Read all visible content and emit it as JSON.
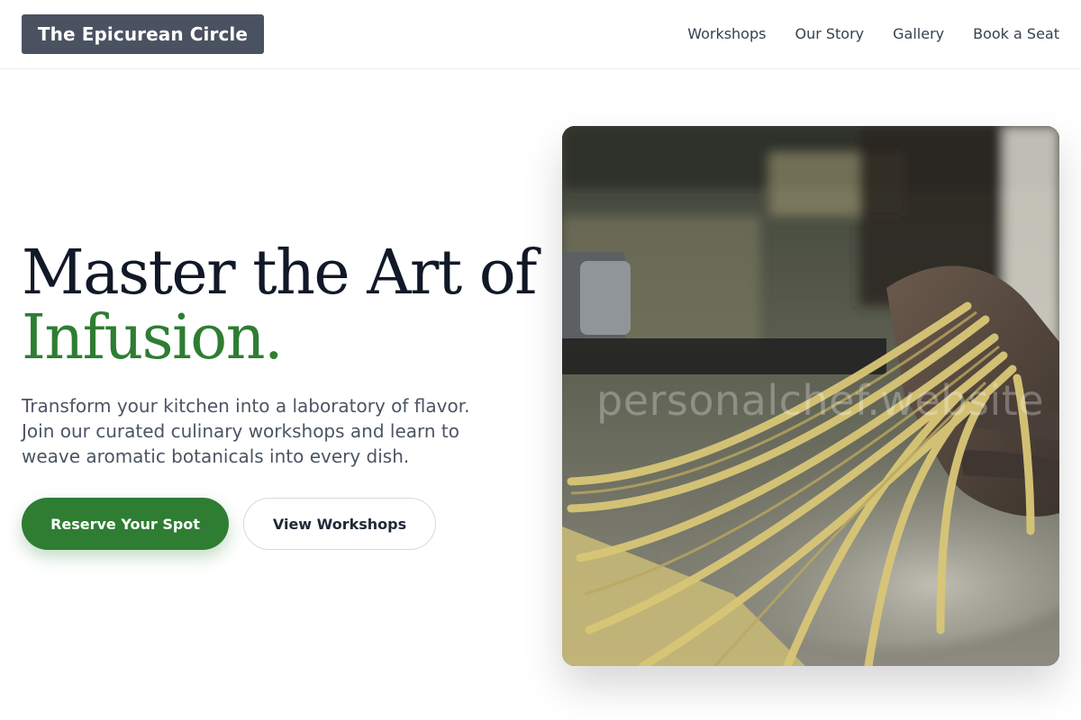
{
  "brand": {
    "name": "The Epicurean Circle"
  },
  "nav": {
    "items": [
      {
        "label": "Workshops"
      },
      {
        "label": "Our Story"
      },
      {
        "label": "Gallery"
      },
      {
        "label": "Book a Seat"
      }
    ]
  },
  "hero": {
    "headline_line1": "Master the Art of",
    "headline_line2": "Infusion.",
    "description": "Transform your kitchen into a laboratory of flavor. Join our curated culinary workshops and learn to weave aromatic botanicals into every dish.",
    "primary_cta": "Reserve Your Spot",
    "secondary_cta": "View Workshops",
    "image": {
      "subject": "hands-holding-fresh-pasta-ribbons",
      "watermark": "personalchef.website"
    }
  },
  "colors": {
    "accent": "#2e7d32",
    "brand_bg": "#4a5261",
    "heading": "#111827",
    "body_text": "#4b5563"
  }
}
